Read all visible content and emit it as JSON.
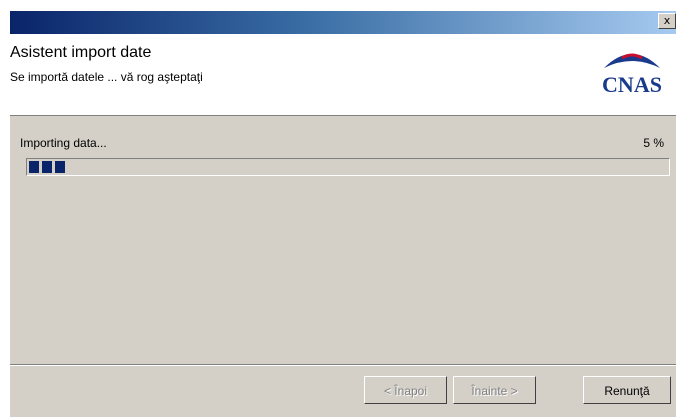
{
  "window": {
    "close_glyph": "x"
  },
  "header": {
    "title": "Asistent import date",
    "subtitle": "Se importă datele ... vă rog aşteptaţi",
    "logo_text": "CNAS"
  },
  "progress": {
    "status_text": "Importing data...",
    "percent_text": "5 %",
    "value_fraction": 0.05
  },
  "buttons": {
    "back_label": "< Înapoi",
    "next_label": "Înainte >",
    "cancel_label": "Renunţă"
  },
  "colors": {
    "title_bar_start": "#0a246a",
    "progress_fill": "#0a246a",
    "panel_bg": "#d4d0c8",
    "logo_blue": "#1a3a8c",
    "logo_red": "#c8102e"
  }
}
